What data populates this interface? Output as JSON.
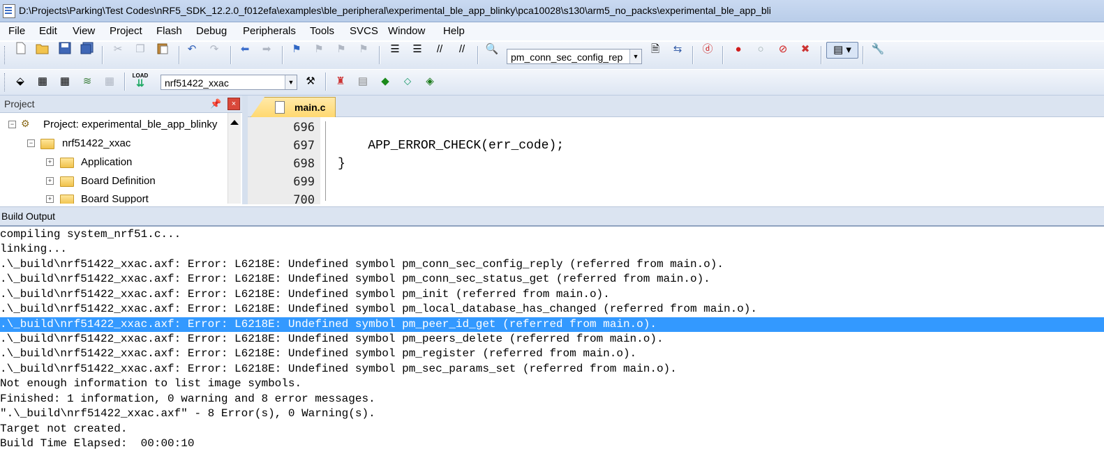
{
  "window": {
    "title": "D:\\Projects\\Parking\\Test Codes\\nRF5_SDK_12.2.0_f012efa\\examples\\ble_peripheral\\experimental_ble_app_blinky\\pca10028\\s130\\arm5_no_packs\\experimental_ble_app_bli"
  },
  "menu": [
    "File",
    "Edit",
    "View",
    "Project",
    "Flash",
    "Debug",
    "Peripherals",
    "Tools",
    "SVCS",
    "Window",
    "Help"
  ],
  "toolbar1": {
    "find_combo_value": "pm_conn_sec_config_rep"
  },
  "toolbar2": {
    "target_combo_value": "nrf51422_xxac",
    "load_label": "LOAD"
  },
  "project_panel": {
    "title": "Project",
    "pin_glyph": "ₕ",
    "close_glyph": "×",
    "tree": [
      {
        "label": "Project: experimental_ble_app_blinky",
        "level": 0,
        "expander": "−"
      },
      {
        "label": "nrf51422_xxac",
        "level": 1,
        "expander": "−"
      },
      {
        "label": "Application",
        "level": 2,
        "expander": "+"
      },
      {
        "label": "Board Definition",
        "level": 2,
        "expander": "+"
      },
      {
        "label": "Board Support",
        "level": 2,
        "expander": "+"
      }
    ]
  },
  "editor": {
    "tab_label": "main.c",
    "line_numbers": [
      "696",
      "697",
      "698",
      "699",
      "700"
    ],
    "lines": [
      "",
      "    APP_ERROR_CHECK(err_code);",
      "}",
      "",
      ""
    ]
  },
  "build_output": {
    "title": "Build Output",
    "selected_index": 7,
    "lines": [
      "compiling system_nrf51.c...",
      "linking...",
      ".\\_build\\nrf51422_xxac.axf: Error: L6218E: Undefined symbol pm_conn_sec_config_reply (referred from main.o).",
      ".\\_build\\nrf51422_xxac.axf: Error: L6218E: Undefined symbol pm_conn_sec_status_get (referred from main.o).",
      ".\\_build\\nrf51422_xxac.axf: Error: L6218E: Undefined symbol pm_init (referred from main.o).",
      ".\\_build\\nrf51422_xxac.axf: Error: L6218E: Undefined symbol pm_local_database_has_changed (referred from main.o).",
      ".\\_build\\nrf51422_xxac.axf: Error: L6218E: Undefined symbol pm_peer_id_get (referred from main.o).",
      ".\\_build\\nrf51422_xxac.axf: Error: L6218E: Undefined symbol pm_peers_delete (referred from main.o).",
      ".\\_build\\nrf51422_xxac.axf: Error: L6218E: Undefined symbol pm_register (referred from main.o).",
      ".\\_build\\nrf51422_xxac.axf: Error: L6218E: Undefined symbol pm_sec_params_set (referred from main.o).",
      "Not enough information to list image symbols.",
      "Finished: 1 information, 0 warning and 8 error messages.",
      "\".\\_build\\nrf51422_xxac.axf\" - 8 Error(s), 0 Warning(s).",
      "Target not created.",
      "Build Time Elapsed:  00:00:10"
    ]
  },
  "colors": {
    "selection": "#3399ff",
    "error_red": "#d9483a",
    "tab_yellow": "#ffd870"
  }
}
